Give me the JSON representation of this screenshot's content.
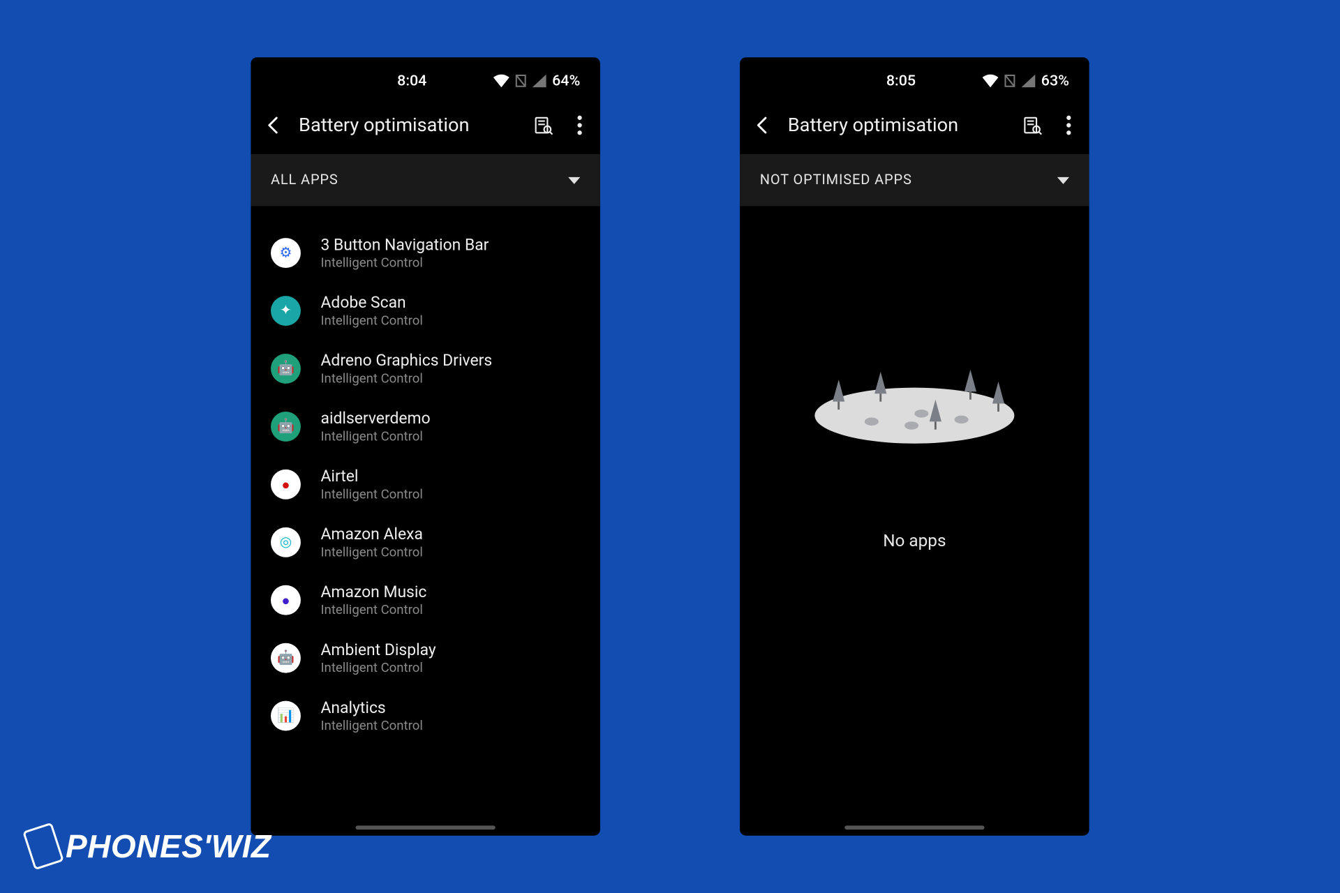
{
  "watermark": "PHONES'WIZ",
  "screens": [
    {
      "statusbar": {
        "time": "8:04",
        "battery": "64%"
      },
      "appbar": {
        "title": "Battery optimisation"
      },
      "filter": {
        "label": "ALL APPS"
      },
      "apps": [
        {
          "name": "3 Button Navigation Bar",
          "sub": "Intelligent Control",
          "bg": "#ffffff",
          "fg": "#2a64ff",
          "glyph": "⚙"
        },
        {
          "name": "Adobe Scan",
          "sub": "Intelligent Control",
          "bg": "#1aa6a6",
          "fg": "#ffffff",
          "glyph": "✦"
        },
        {
          "name": "Adreno Graphics Drivers",
          "sub": "Intelligent Control",
          "bg": "#1fa07a",
          "fg": "#ffffff",
          "glyph": "🤖"
        },
        {
          "name": "aidlserverdemo",
          "sub": "Intelligent Control",
          "bg": "#1fa07a",
          "fg": "#ffffff",
          "glyph": "🤖"
        },
        {
          "name": "Airtel",
          "sub": "Intelligent Control",
          "bg": "#ffffff",
          "fg": "#d40d0d",
          "glyph": "●"
        },
        {
          "name": "Amazon Alexa",
          "sub": "Intelligent Control",
          "bg": "#ffffff",
          "fg": "#07b6c9",
          "glyph": "◎"
        },
        {
          "name": "Amazon Music",
          "sub": "Intelligent Control",
          "bg": "#ffffff",
          "fg": "#3e1ecf",
          "glyph": "●"
        },
        {
          "name": "Ambient Display",
          "sub": "Intelligent Control",
          "bg": "#ffffff",
          "fg": "#2fbf48",
          "glyph": "🤖"
        },
        {
          "name": "Analytics",
          "sub": "Intelligent Control",
          "bg": "#ffffff",
          "fg": "#ff9b00",
          "glyph": "📊"
        }
      ]
    },
    {
      "statusbar": {
        "time": "8:05",
        "battery": "63%"
      },
      "appbar": {
        "title": "Battery optimisation"
      },
      "filter": {
        "label": "NOT OPTIMISED APPS"
      },
      "empty": {
        "text": "No apps"
      }
    }
  ]
}
